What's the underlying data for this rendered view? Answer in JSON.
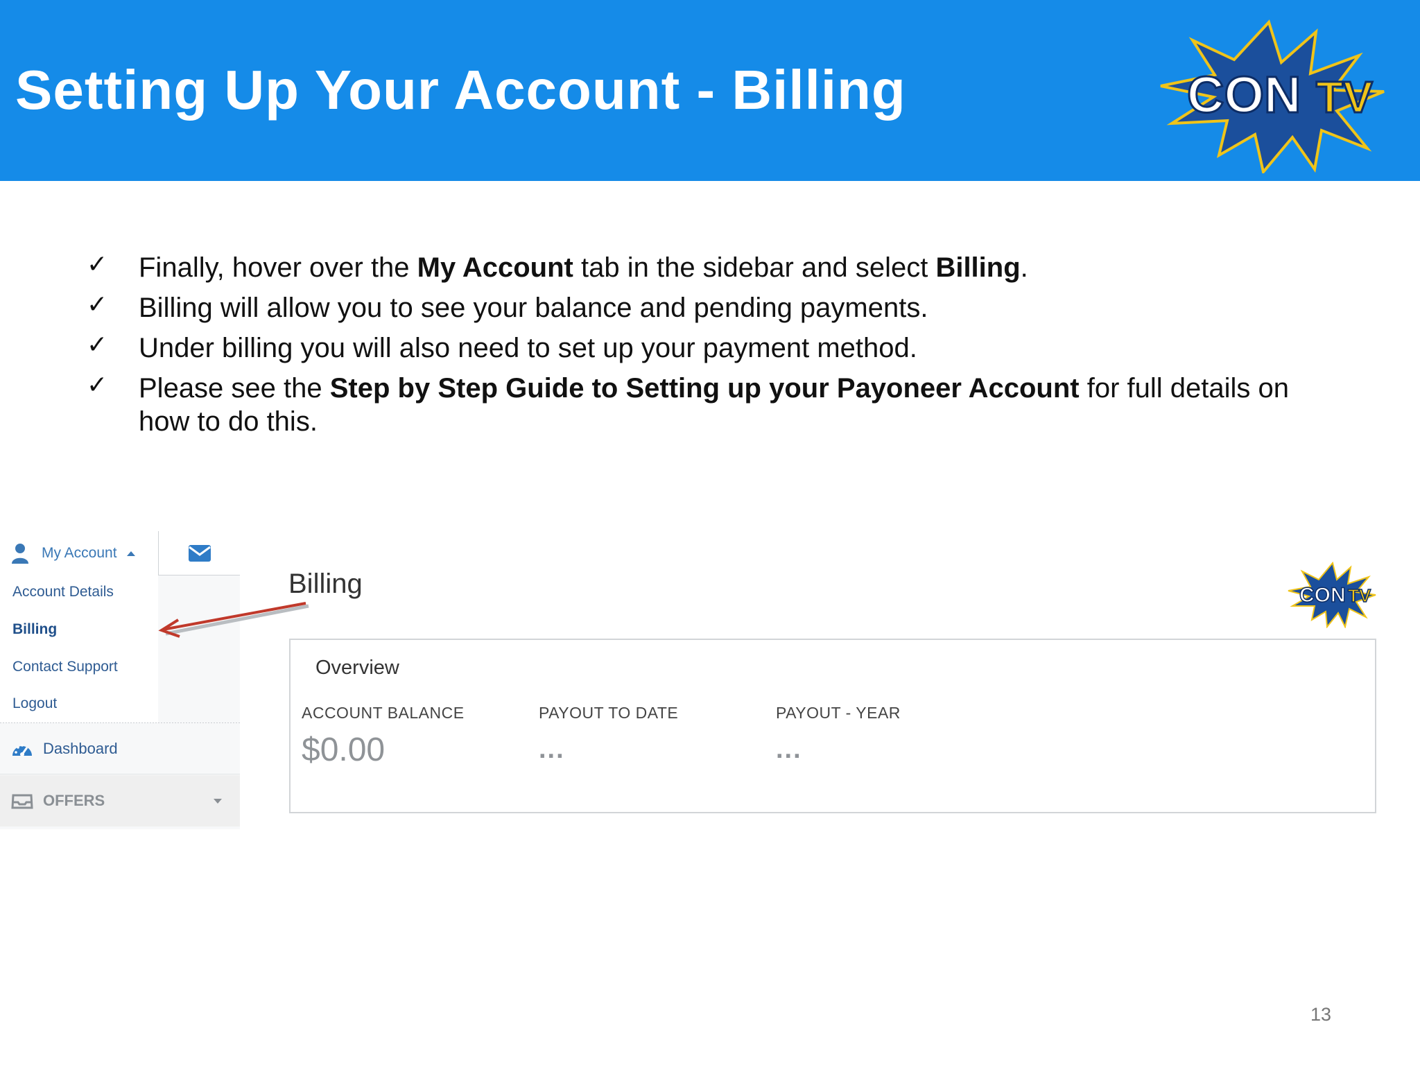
{
  "slide": {
    "title": "Setting Up Your Account - Billing",
    "page_number": "13",
    "logo_text": "CONTV"
  },
  "bullets": [
    {
      "check": "✓",
      "parts": [
        "Finally, hover over the ",
        "My Account",
        " tab in the sidebar and select ",
        "Billing",
        "."
      ]
    },
    {
      "check": "✓",
      "text": "Billing will allow you to see your balance and pending payments."
    },
    {
      "check": "✓",
      "text": "Under billing you will also need to set up your payment method."
    },
    {
      "check": "✓",
      "parts": [
        "Please see the ",
        "Step by Step Guide to Setting up your Payoneer Account",
        " for full details on how to do this."
      ]
    }
  ],
  "sidebar": {
    "my_account_label": "My Account",
    "items": [
      "Account Details",
      "Billing",
      "Contact Support",
      "Logout"
    ],
    "dashboard_label": "Dashboard",
    "offers_label": "OFFERS"
  },
  "billing_page": {
    "title": "Billing",
    "overview": {
      "title": "Overview",
      "columns": [
        {
          "label": "ACCOUNT BALANCE",
          "value": "$0.00"
        },
        {
          "label": "PAYOUT TO DATE",
          "value": "..."
        },
        {
          "label": "PAYOUT - YEAR",
          "value": "..."
        }
      ]
    }
  },
  "colors": {
    "header_blue": "#158be8",
    "link_blue": "#2e5b92",
    "arrow_red": "#c0392b",
    "muted_gray": "#8f9397"
  },
  "icons": [
    "user-icon",
    "envelope-icon",
    "dashboard-gauge-icon",
    "inbox-icon",
    "caret-up-icon",
    "caret-down-icon"
  ]
}
